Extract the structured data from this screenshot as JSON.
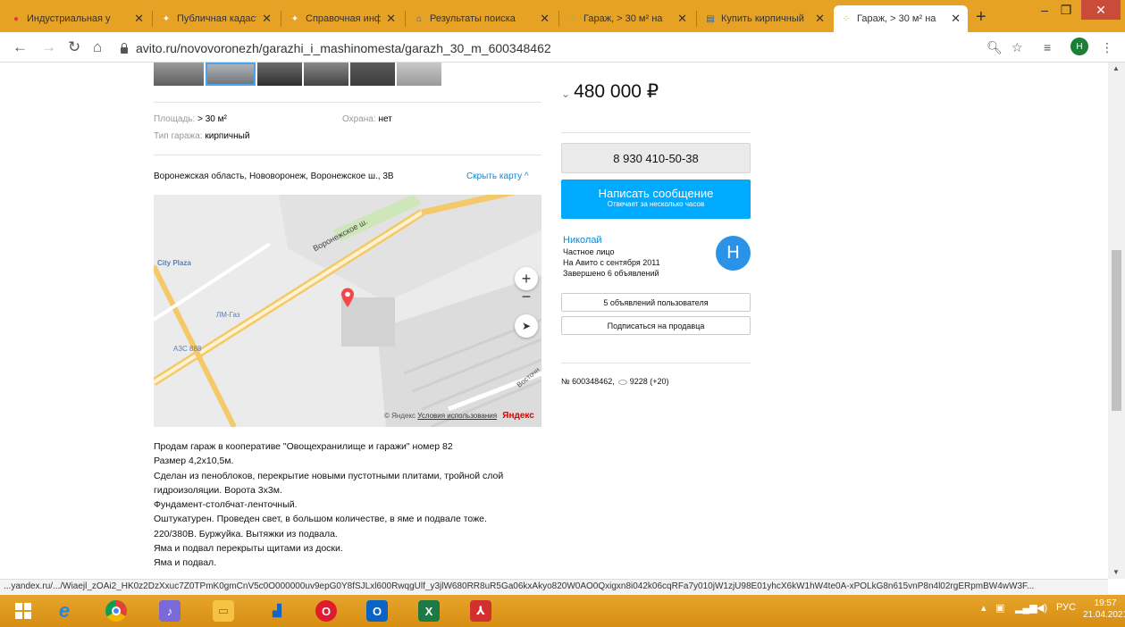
{
  "browser": {
    "tabs": [
      {
        "label": "Индустриальная у",
        "icon": "location-pin-icon",
        "color": "#e53935"
      },
      {
        "label": "Публичная кадаст",
        "icon": "star-icon",
        "color": "#e6a225"
      },
      {
        "label": "Справочная инфо",
        "icon": "star-icon",
        "color": "#e6a225"
      },
      {
        "label": "Результаты поиска",
        "icon": "building-icon",
        "color": "#1565c0"
      },
      {
        "label": "Гараж, > 30 м² на",
        "icon": "avito-icon",
        "color": "#7cb342"
      },
      {
        "label": "Купить кирпичный",
        "icon": "document-icon",
        "color": "#1565c0"
      },
      {
        "label": "Гараж, > 30 м² на",
        "icon": "avito-icon",
        "color": "#7cb342"
      }
    ],
    "close_glyph": "✕",
    "new_tab": "+",
    "url": "avito.ru/novovoronezh/garazhi_i_mashinomesta/garazh_30_m_600348462",
    "profile_initial": "Н",
    "status_url": "...yandex.ru/.../Wiaejl_zOAi2_HK0z2DzXxuc7Z0TPmK0gmCnV5c0O000000uv9epG0Y8fSJLxl600RwqgUlf_y3jlW680RR8uR5Ga06kxAkyo820W0AO0Qxigxn8i042k06cqRFa7y010jW1zjU98E01yhcX6kW1hW4te0A-xPOLkG8n615vnP8n4l02rgERpmBW4wW3F..."
  },
  "listing": {
    "params": {
      "area_label": "Площадь:",
      "area_value": "> 30 м²",
      "guard_label": "Охрана:",
      "guard_value": "нет",
      "type_label": "Тип гаража:",
      "type_value": "кирпичный"
    },
    "address": "Воронежская область, Нововоронеж, Воронежское ш., 3В",
    "hide_map": "Скрыть карту ^",
    "map": {
      "street": "Воронежское ш.",
      "labels": [
        "City Plaza",
        "ЛМ-Газ",
        "АЗС 888",
        "Восточн"
      ],
      "copyright": "© Яндекс",
      "terms": "Условия использования",
      "brand": "Яндекс"
    },
    "description": [
      "Продам гараж в кооперативе \"Овощехранилище и гаражи\" номер 82",
      "Размер 4,2х10,5м.",
      "Сделан из пеноблоков, перекрытие новыми пустотными плитами, тройной слой",
      "гидроизоляции. Ворота 3х3м.",
      "Фундамент-столбчат-ленточный.",
      "Оштукатурен. Проведен свет, в большом количестве, в яме и подвале тоже.",
      "220/380В. Буржуйка. Вытяжки из подвала.",
      "Яма и подвал перекрыты щитами из доски.",
      "Яма и подвал."
    ],
    "price": "480 000 ₽",
    "phone": "8 930 410-50-38",
    "message_btn": "Написать сообщение",
    "message_sub": "Отвечает за несколько часов",
    "seller": {
      "name": "Николай",
      "type": "Частное лицо",
      "since": "На Авито с сентября 2011",
      "done": "Завершено 6 объявлений",
      "initial": "Н"
    },
    "user_ads_btn": "5 объявлений пользователя",
    "subscribe_btn": "Подписаться на продавца",
    "ad_number": "№ 600348462,",
    "views": "9228 (+20)"
  },
  "taskbar": {
    "lang": "РУС",
    "time": "19:57",
    "date": "21.04.2021"
  }
}
